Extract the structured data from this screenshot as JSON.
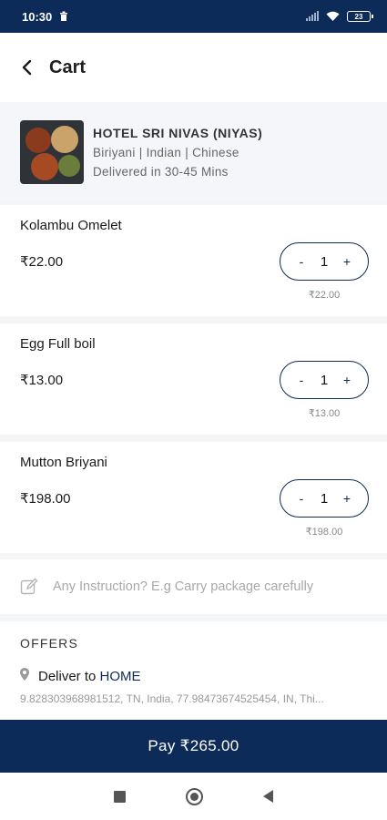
{
  "status_bar": {
    "time": "10:30",
    "battery": "23"
  },
  "header": {
    "title": "Cart"
  },
  "hotel": {
    "name": "HOTEL SRI NIVAS (NIYAS)",
    "cuisines": "Biriyani | Indian | Chinese",
    "delivery_time": "Delivered in 30-45 Mins"
  },
  "items": [
    {
      "name": "Kolambu Omelet",
      "price": "₹22.00",
      "quantity": "1",
      "total": "₹22.00"
    },
    {
      "name": "Egg Full boil",
      "price": "₹13.00",
      "quantity": "1",
      "total": "₹13.00"
    },
    {
      "name": "Mutton Briyani",
      "price": "₹198.00",
      "quantity": "1",
      "total": "₹198.00"
    }
  ],
  "stepper": {
    "minus": "-",
    "plus": "+"
  },
  "instruction": {
    "placeholder": "Any Instruction? E.g Carry package carefully"
  },
  "offers": {
    "title": "OFFERS",
    "deliver_label": "Deliver to",
    "deliver_target": "HOME",
    "address": "9.828303968981512, TN, India, 77.98473674525454, IN, Thi..."
  },
  "pay": {
    "label": "Pay ₹265.00"
  },
  "colors": {
    "primary": "#0d2b59",
    "background": "#f4f5f7"
  },
  "icons": [
    "trash-icon",
    "signal-icon",
    "wifi-icon",
    "battery-icon",
    "back-arrow-icon",
    "edit-icon",
    "location-pin-icon",
    "nav-square-icon",
    "nav-home-icon",
    "nav-back-icon"
  ]
}
